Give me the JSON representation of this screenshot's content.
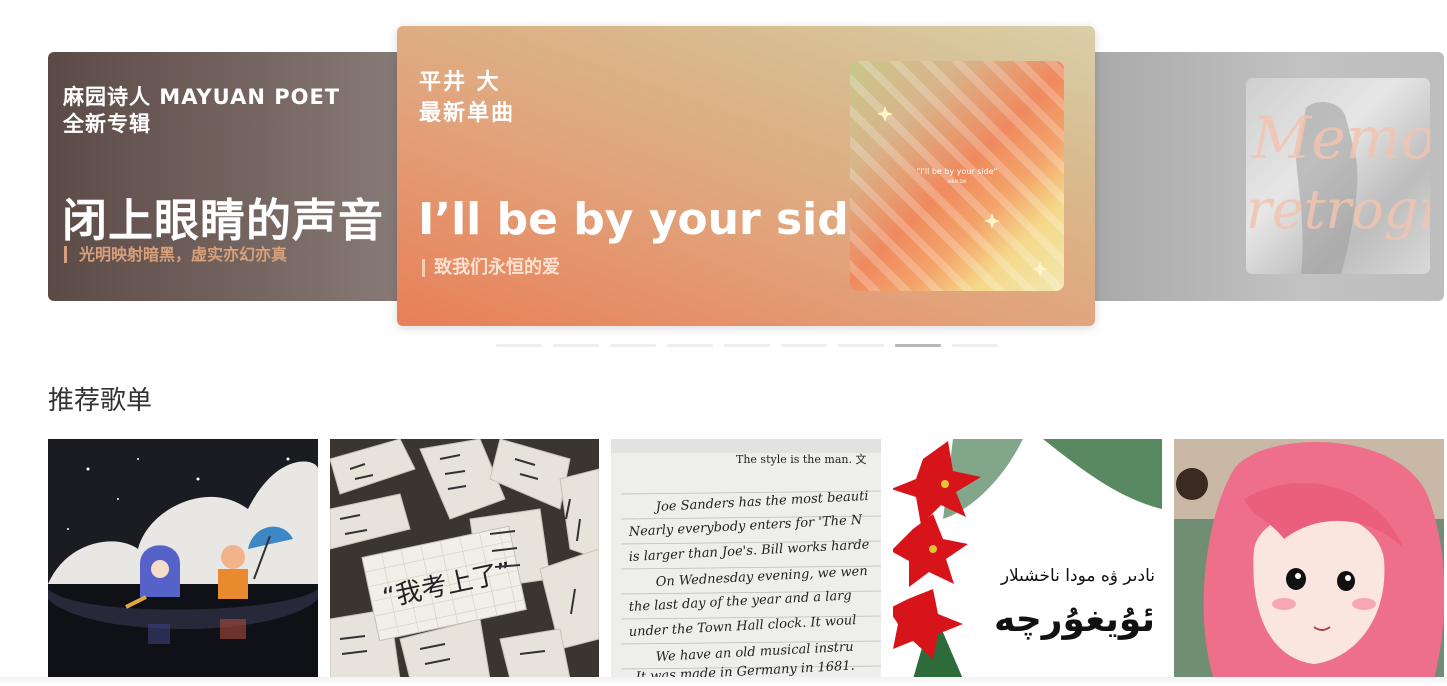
{
  "banners": {
    "left": {
      "artist_line1": "麻园诗人 MAYUAN POET",
      "artist_line2": "全新专辑",
      "title": "闭上眼睛的声音",
      "subtitle": "光明映射暗黑，虚实亦幻亦真"
    },
    "center": {
      "artist_line1": "平井 大",
      "artist_line2": "最新单曲",
      "title": "I’ll be by your side",
      "subtitle": "致我们永恒的爱",
      "album_caption": "\"I'll be by your side\"",
      "album_caption_small": "HIRAI DAI"
    },
    "right": {
      "cover_text": "Memory retrograde"
    }
  },
  "carousel": {
    "dot_count": 9,
    "active_index": 7
  },
  "section": {
    "title": "推荐歌单"
  },
  "playlists": [
    {
      "name": "playlist-1",
      "theme": "cartoon-night-clouds"
    },
    {
      "name": "playlist-2",
      "theme": "paper-strips-handwriting",
      "text": "“我考上了”"
    },
    {
      "name": "playlist-3",
      "theme": "handwriting-notebook",
      "lines": [
        "The style is the man. 文",
        "Joe Sanders has the most beauti",
        "Nearly everybody enters for 'The N",
        "is larger than Joe's. Bill works harde",
        "On Wednesday evening, we wen",
        "the last day of the year and a larg",
        "under the Town Hall clock. It woul",
        "We have an old musical instru",
        "It was made in Germany in 1681."
      ]
    },
    {
      "name": "playlist-4",
      "theme": "poinsettia-uyghur",
      "text_line1": "نادىر ۋە مودا ناخشىلار",
      "text_line2": "ئۇيغۇرچە"
    },
    {
      "name": "playlist-5",
      "theme": "pink-hair-cartoon"
    }
  ],
  "colors": {
    "accent_orange": "#e87f58",
    "dot_active": "#b7b7b7",
    "dot_inactive": "#eeeeee"
  }
}
